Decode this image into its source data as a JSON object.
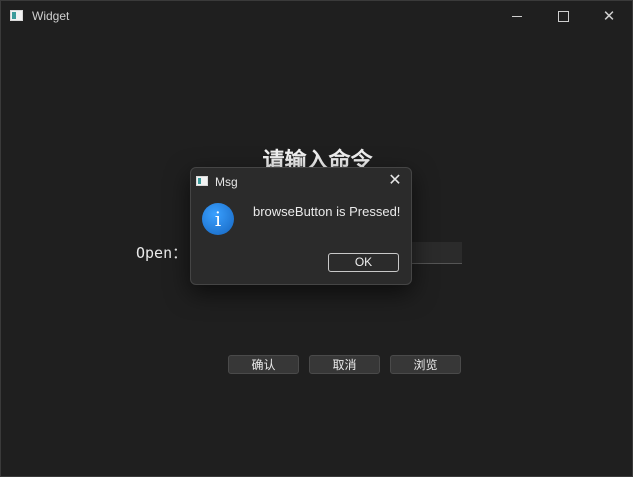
{
  "window": {
    "title": "Widget",
    "controls": {
      "minimize": "minimize-icon",
      "maximize": "maximize-icon",
      "close": "close-icon",
      "close_glyph": "✕"
    }
  },
  "main": {
    "heading": "请输入命令",
    "open_label": "Open：",
    "open_value": "",
    "buttons": {
      "confirm": "确认",
      "cancel": "取消",
      "browse": "浏览"
    }
  },
  "dialog": {
    "title": "Msg",
    "close_glyph": "✕",
    "icon": "info-icon",
    "icon_glyph": "i",
    "message": "browseButton is Pressed!",
    "ok_label": "OK"
  },
  "colors": {
    "background": "#1f1f1f",
    "dialog_background": "#2b2b2b",
    "info_blue": "#1e88e5"
  }
}
